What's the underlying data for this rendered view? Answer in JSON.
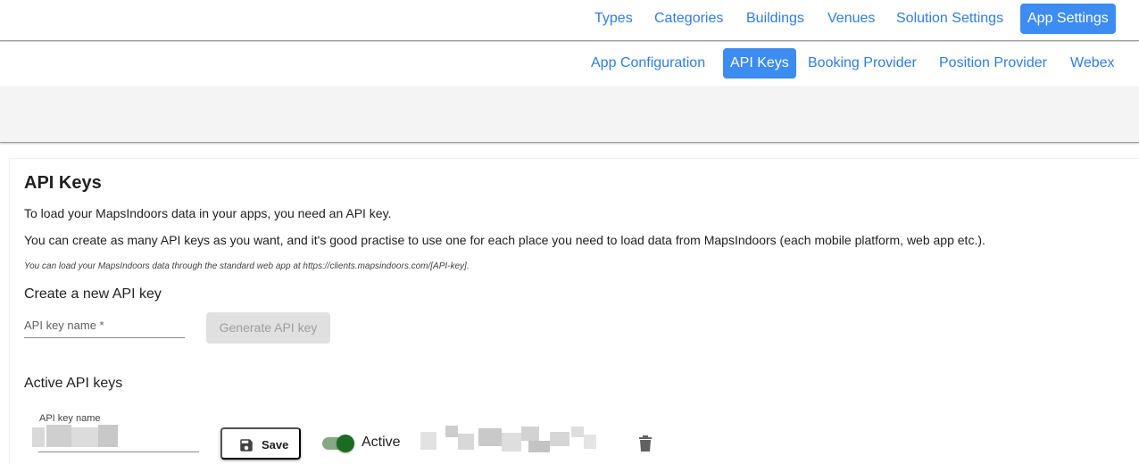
{
  "topnav": {
    "items": [
      {
        "label": "Types"
      },
      {
        "label": "Categories"
      },
      {
        "label": "Buildings"
      },
      {
        "label": "Venues"
      },
      {
        "label": "Solution Settings"
      },
      {
        "label": "App Settings",
        "active": true
      }
    ]
  },
  "subnav": {
    "items": [
      {
        "label": "App Configuration"
      },
      {
        "label": "API Keys",
        "active": true
      },
      {
        "label": "Booking Provider"
      },
      {
        "label": "Position Provider"
      },
      {
        "label": "Webex"
      }
    ]
  },
  "page": {
    "title": "API Keys",
    "description1": "To load your MapsIndoors data in your apps, you need an API key.",
    "description2": "You can create as many API keys as you want, and it's good practise to use one for each place you need to load data from MapsIndoors (each mobile platform, web app etc.).",
    "hint": "You can load your MapsIndoors data through the standard web app at https://clients.mapsindoors.com/[API-key]."
  },
  "create": {
    "title": "Create a new API key",
    "input_placeholder": "API key name *",
    "generate_label": "Generate API key"
  },
  "active_keys": {
    "title": "Active API keys",
    "rows": [
      {
        "name_label": "API key name",
        "save_label": "Save",
        "toggle_label": "Active",
        "enabled": true
      }
    ]
  },
  "colors": {
    "accent": "#3c8cf1",
    "link": "#2f7de1",
    "toggle_on": "#1b6b21",
    "disabled_bg": "#e0e0e0"
  },
  "icons": {
    "save": "floppy-disk-icon",
    "delete": "trash-icon"
  }
}
